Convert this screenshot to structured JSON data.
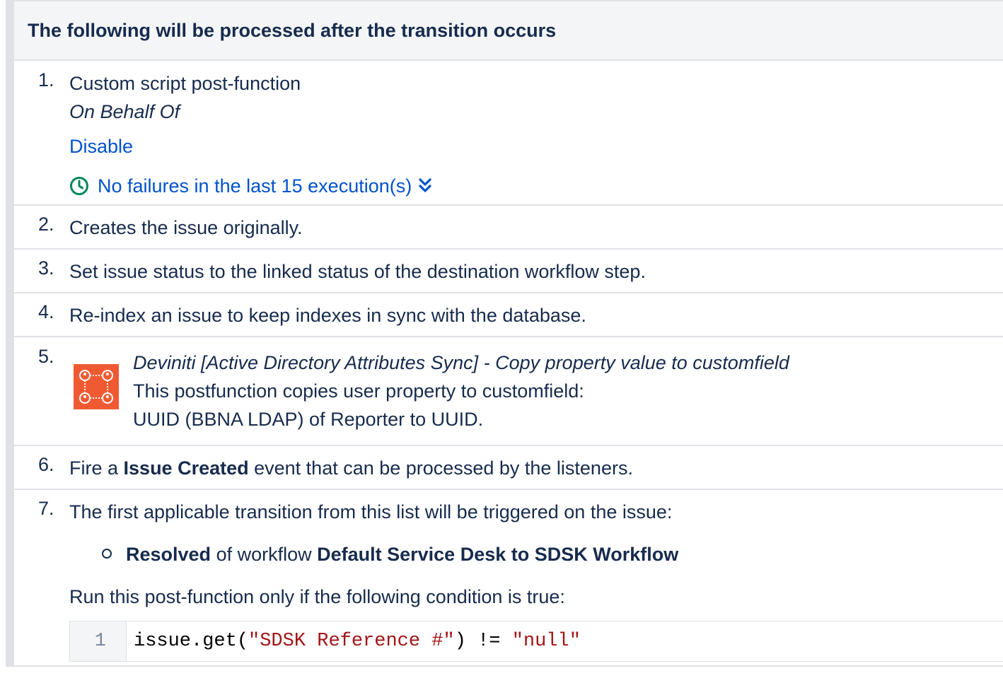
{
  "header": {
    "title": "The following will be processed after the transition occurs"
  },
  "items": [
    {
      "number": "1.",
      "title": "Custom script post-function",
      "subtitle": "On Behalf Of",
      "action_link": "Disable",
      "failures_text": "No failures in the last 15 execution(s)"
    },
    {
      "number": "2.",
      "text": "Creates the issue originally."
    },
    {
      "number": "3.",
      "text": "Set issue status to the linked status of the destination workflow step."
    },
    {
      "number": "4.",
      "text": "Re-index an issue to keep indexes in sync with the database."
    },
    {
      "number": "5.",
      "title": "Deviniti [Active Directory Attributes Sync] - Copy property value to customfield",
      "line1": "This postfunction copies user property to customfield:",
      "line2": "UUID (BBNA LDAP) of Reporter to UUID."
    },
    {
      "number": "6.",
      "text_before": "Fire a ",
      "event_name": "Issue Created",
      "text_after": " event that can be processed by the listeners."
    },
    {
      "number": "7.",
      "text": "The first applicable transition from this list will be triggered on the issue:",
      "transition": {
        "name": "Resolved",
        "middle": " of workflow ",
        "workflow": "Default Service Desk to SDSK Workflow"
      },
      "condition_label": "Run this post-function only if the following condition is true:",
      "code": {
        "line_number": "1",
        "tok_prefix": "issue.get(",
        "tok_string": "\"SDSK Reference #\"",
        "tok_mid": ") != ",
        "tok_value": "\"null\""
      }
    }
  ],
  "colors": {
    "link": "#0052cc",
    "success_icon": "#00875a",
    "plugin_icon_bg": "#f05a33"
  },
  "icons": {
    "failures": "clock-check-icon",
    "expand": "chevron-double-down-icon",
    "plugin": "deviniti-ad-sync-icon"
  }
}
